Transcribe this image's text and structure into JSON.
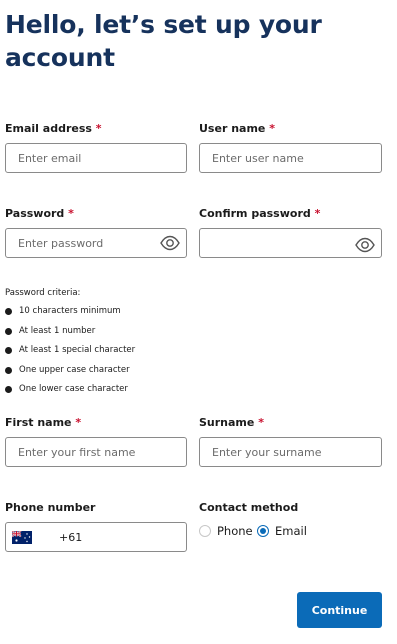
{
  "page_title": "Hello, let’s set up your account",
  "required_marker": "*",
  "fields": {
    "email": {
      "label": "Email address",
      "placeholder": "Enter email",
      "value": ""
    },
    "username": {
      "label": "User name",
      "placeholder": "Enter user name",
      "value": ""
    },
    "password": {
      "label": "Password",
      "placeholder": "Enter password",
      "value": ""
    },
    "confirm_password": {
      "label": "Confirm password",
      "placeholder": "",
      "value": ""
    },
    "first_name": {
      "label": "First name",
      "placeholder": "Enter your first name",
      "value": ""
    },
    "surname": {
      "label": "Surname",
      "placeholder": "Enter your surname",
      "value": ""
    },
    "phone": {
      "label": "Phone number",
      "country_icon": "australia-flag-icon",
      "dial_code": "+61",
      "value": ""
    }
  },
  "password_criteria": {
    "title": "Password criteria:",
    "items": [
      "10 characters minimum",
      "At least 1 number",
      "At least 1 special character",
      "One upper case character",
      "One lower case character"
    ]
  },
  "contact_method": {
    "label": "Contact method",
    "options": [
      "Phone",
      "Email"
    ],
    "selected": "Email"
  },
  "continue_label": "Continue",
  "colors": {
    "title": "#16325c",
    "accent": "#0b6bb8",
    "required": "#c8102e",
    "border": "#8a8a8a"
  },
  "icons": [
    "eye-icon",
    "australia-flag-icon",
    "bullet-icon"
  ]
}
